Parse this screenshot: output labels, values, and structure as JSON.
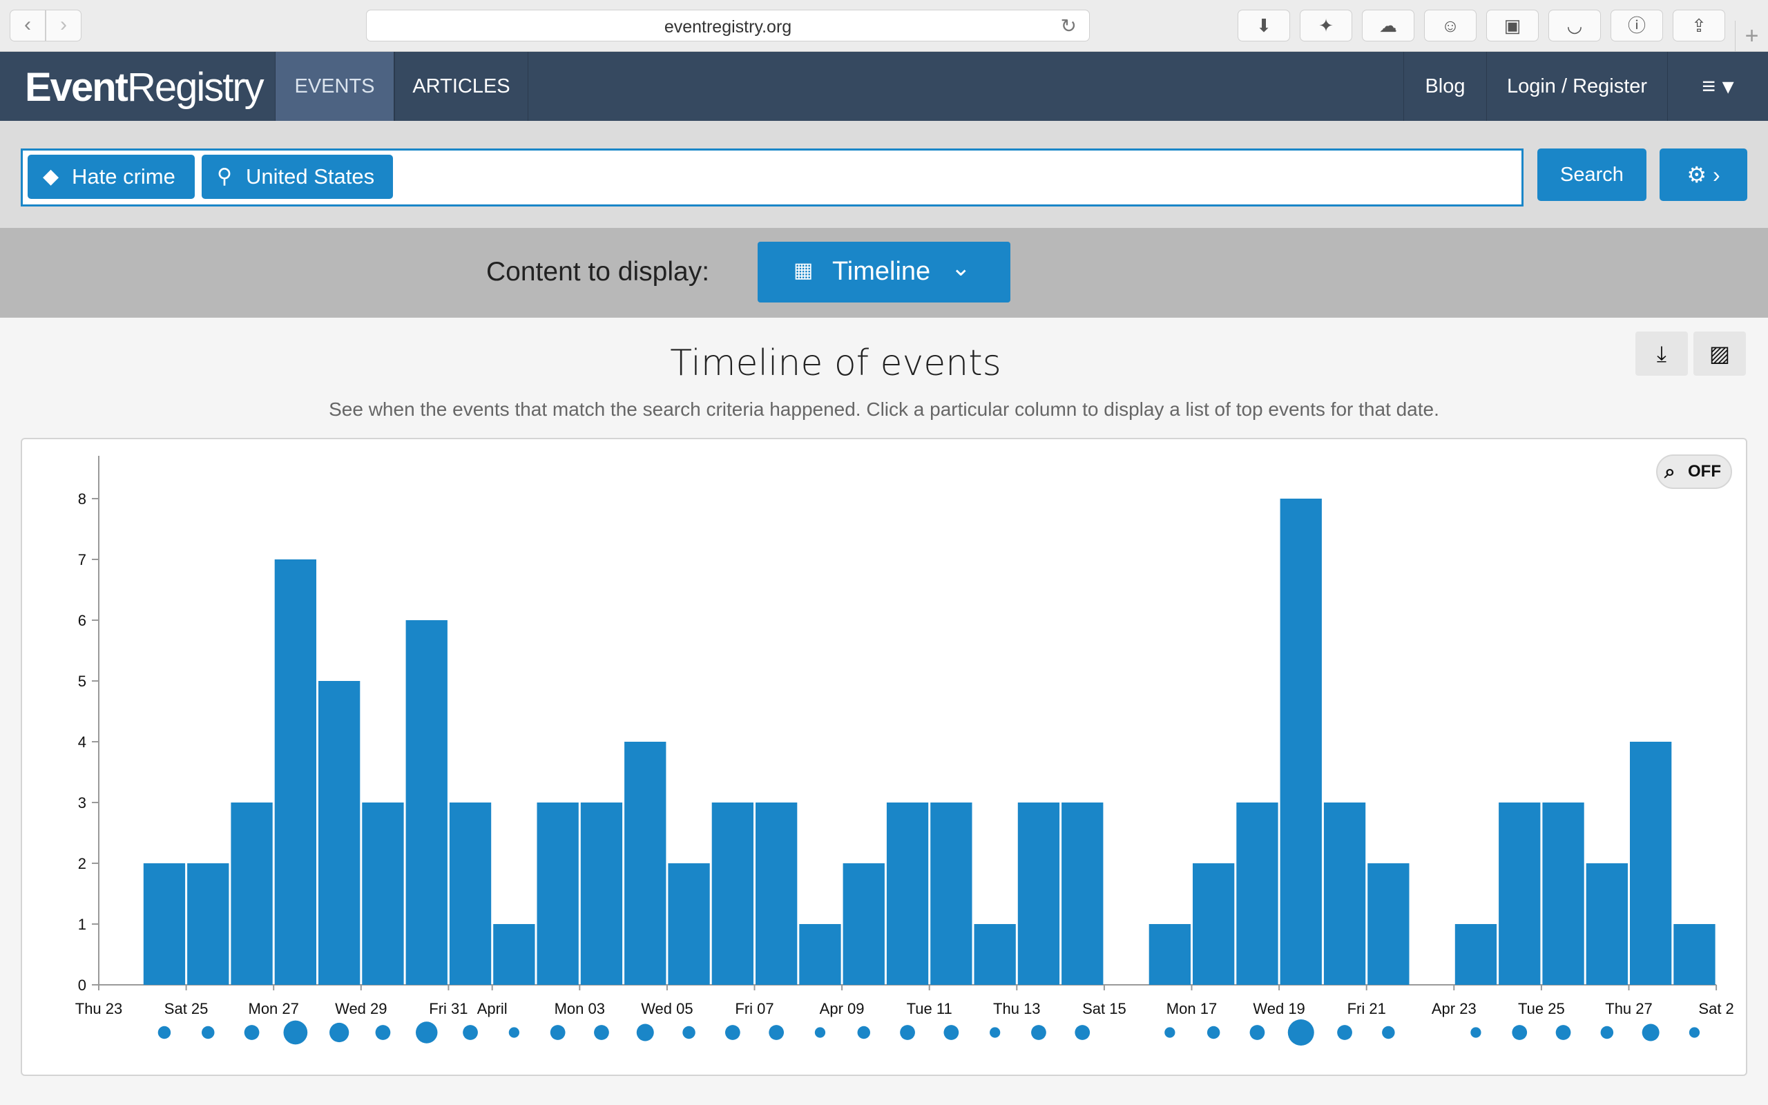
{
  "browser": {
    "url": "eventregistry.org",
    "back_glyph": "‹",
    "forward_glyph": "›",
    "reload_glyph": "↻",
    "new_tab_glyph": "+",
    "toolbar_icons": [
      "download-icon",
      "magic-wand-icon",
      "cloud-icon",
      "ghost-icon",
      "reader-icon",
      "tray-icon",
      "password-icon",
      "share-icon"
    ],
    "toolbar_glyphs": [
      "⬇",
      "✦",
      "☁",
      "☺",
      "▣",
      "◡",
      "ⓘ",
      "⇪"
    ]
  },
  "navbar": {
    "logo_bold": "Event",
    "logo_regular": "Registry",
    "tabs": [
      {
        "label": "EVENTS",
        "active": true
      },
      {
        "label": "ARTICLES",
        "active": false
      }
    ],
    "blog_label": "Blog",
    "login_label": "Login / Register",
    "menu_glyph": "≡ ▾"
  },
  "search": {
    "chips": [
      {
        "label": "Hate crime",
        "icon": "tag-icon",
        "glyph": "◆"
      },
      {
        "label": "United States",
        "icon": "location-pin-icon",
        "glyph": "⚲"
      }
    ],
    "search_label": "Search",
    "settings_glyph": "⚙ ›"
  },
  "content": {
    "label": "Content to display:",
    "selected": "Timeline",
    "calendar_glyph": "▦",
    "chevron_glyph": "⌄"
  },
  "timeline": {
    "title": "Timeline of events",
    "subtitle": "See when the events that match the search criteria happened. Click a particular column to display a list of top events for that date.",
    "download_glyph": "⤓",
    "image_glyph": "▨",
    "zoom_label": "OFF",
    "zoom_glyph": "⌕"
  },
  "chart_data": {
    "type": "bar",
    "accent_color": "#1a86c8",
    "start_date": "2017-03-23",
    "values": [
      0,
      2,
      2,
      3,
      7,
      5,
      3,
      6,
      3,
      1,
      3,
      3,
      4,
      2,
      3,
      3,
      1,
      2,
      3,
      3,
      1,
      3,
      3,
      0,
      1,
      2,
      3,
      8,
      3,
      2,
      0,
      1,
      3,
      3,
      2,
      4,
      1
    ],
    "x_tick_labels": [
      "Thu 23",
      "Sat 25",
      "Mon 27",
      "Wed 29",
      "Fri 31",
      "April",
      "Mon 03",
      "Wed 05",
      "Fri 07",
      "Apr 09",
      "Tue 11",
      "Thu 13",
      "Sat 15",
      "Mon 17",
      "Wed 19",
      "Fri 21",
      "Apr 23",
      "Tue 25",
      "Thu 27",
      "Sat 2"
    ],
    "x_tick_dates": [
      "2017-03-23",
      "2017-03-25",
      "2017-03-27",
      "2017-03-29",
      "2017-03-31",
      "2017-04-01",
      "2017-04-03",
      "2017-04-05",
      "2017-04-07",
      "2017-04-09",
      "2017-04-11",
      "2017-04-13",
      "2017-04-15",
      "2017-04-17",
      "2017-04-19",
      "2017-04-21",
      "2017-04-23",
      "2017-04-25",
      "2017-04-27",
      "2017-04-29"
    ],
    "y_ticks": [
      0,
      1,
      2,
      3,
      4,
      5,
      6,
      7,
      8
    ],
    "ylim": [
      0,
      8.5
    ],
    "xlabel": "",
    "ylabel": "",
    "grid": false,
    "bubbles": true
  }
}
